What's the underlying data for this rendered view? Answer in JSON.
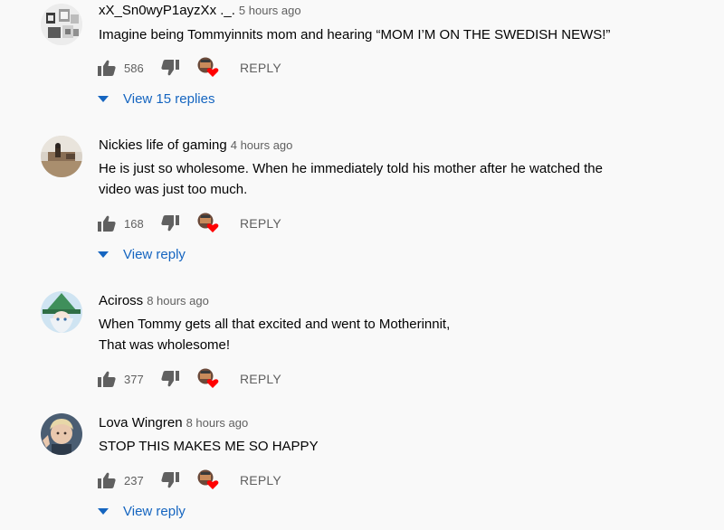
{
  "comments": [
    {
      "author": "xX_Sn0wyP1ayzXx ._.",
      "time": "5 hours ago",
      "lines": [
        "Imagine being Tommyinnits mom and hearing “MOM I’M ON THE SWEDISH NEWS!”"
      ],
      "likes": "586",
      "reply_label": "REPLY",
      "view_replies": "View 15 replies",
      "avatar_icon": "pixel-art-avatar"
    },
    {
      "author": "Nickies life of gaming",
      "time": "4 hours ago",
      "lines": [
        "He is just so wholesome. When he immediately told his mother after he watched the",
        "video was just too much."
      ],
      "likes": "168",
      "reply_label": "REPLY",
      "view_replies": "View reply",
      "avatar_icon": "photo-avatar"
    },
    {
      "author": "Aciross",
      "time": "8 hours ago",
      "lines": [
        "When Tommy gets all that excited and went to Motherinnit,",
        "That was wholesome!"
      ],
      "likes": "377",
      "reply_label": "REPLY",
      "view_replies": "",
      "avatar_icon": "anime-wizard-avatar"
    },
    {
      "author": "Lova Wingren",
      "time": "8 hours ago",
      "lines": [
        "STOP THIS MAKES ME SO HAPPY"
      ],
      "likes": "237",
      "reply_label": "REPLY",
      "view_replies": "View reply",
      "avatar_icon": "photo-avatar"
    }
  ],
  "colors": {
    "background": "#f9f9f9",
    "text": "#030303",
    "secondary": "#606060",
    "link": "#1565c0",
    "heart": "#ff0000"
  }
}
